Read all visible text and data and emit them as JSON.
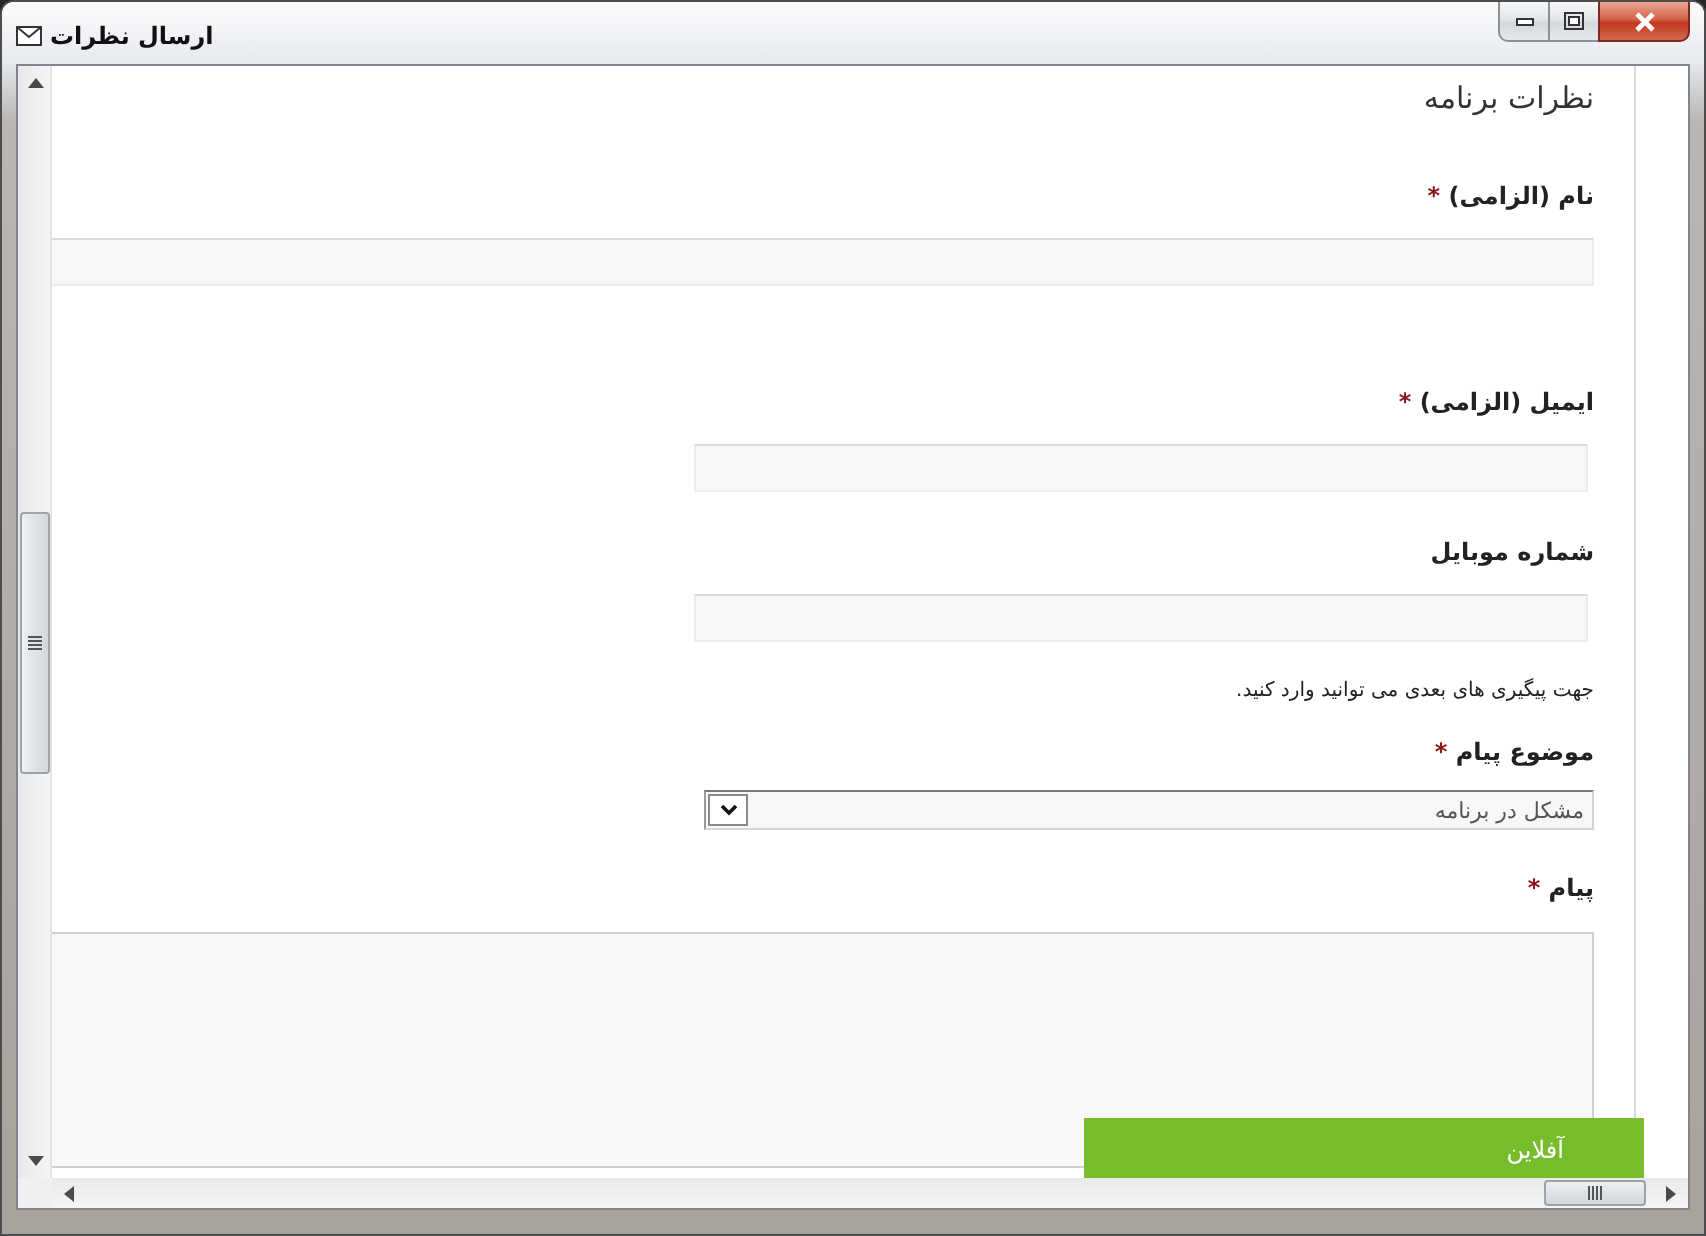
{
  "window": {
    "title": "ارسال نظرات"
  },
  "form": {
    "heading": "نظرات برنامه",
    "fields": [
      {
        "kind": "text",
        "label": "نام (الزامی)",
        "required_mark": "*"
      },
      {
        "kind": "text",
        "label": "ایمیل (الزامی)",
        "required_mark": "*"
      },
      {
        "kind": "text",
        "label": "شماره موبایل",
        "help": "جهت پیگیری های بعدی می توانید وارد کنید."
      },
      {
        "kind": "select",
        "label": "موضوع پیام",
        "required_mark": "*",
        "value": "مشکل در برنامه"
      },
      {
        "kind": "textarea",
        "label": "پیام",
        "required_mark": "*"
      }
    ]
  },
  "chat_button": {
    "label": "آفلاین"
  }
}
